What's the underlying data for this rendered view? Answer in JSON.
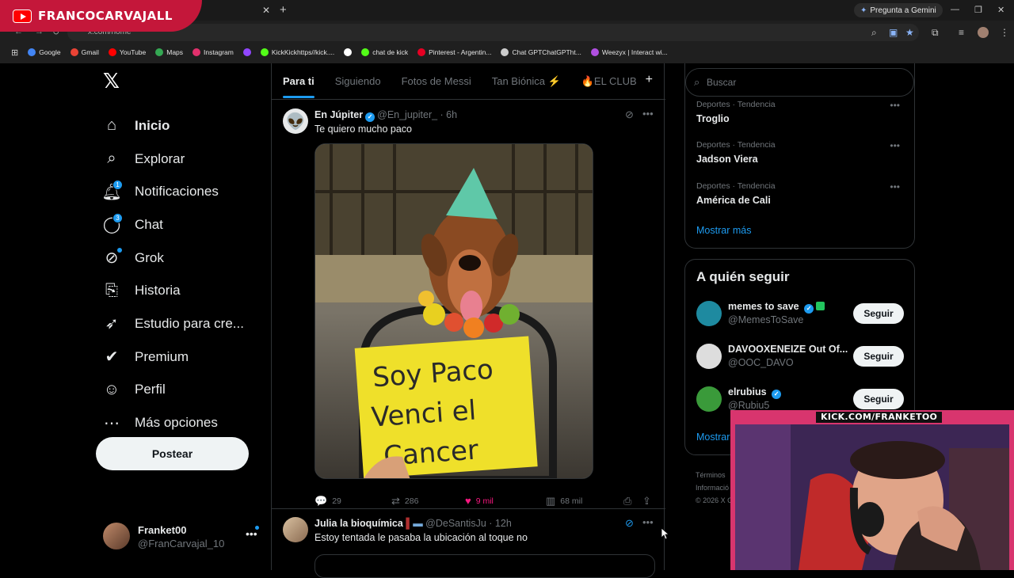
{
  "banner": {
    "title": "FRANCOCARVAJALL"
  },
  "browser": {
    "address": "x.com/home",
    "gemini_label": "Pregunta a Gemini",
    "bookmarks": [
      {
        "label": "Google",
        "color": "#4285f4"
      },
      {
        "label": "Gmail",
        "color": "#ea4335"
      },
      {
        "label": "YouTube",
        "color": "#ff0000"
      },
      {
        "label": "Maps",
        "color": "#34a853"
      },
      {
        "label": "Instagram",
        "color": "#e1306c"
      },
      {
        "label": "",
        "color": "#9146ff"
      },
      {
        "label": "KickKickhttps//kick....",
        "color": "#53fc18"
      },
      {
        "label": "",
        "color": "#ffffff"
      },
      {
        "label": "chat de kick",
        "color": "#53fc18"
      },
      {
        "label": "Pinterest - Argentin...",
        "color": "#e60023"
      },
      {
        "label": "Chat GPTChatGPTht...",
        "color": "#cccccc"
      },
      {
        "label": "Weezyx | Interact wi...",
        "color": "#b04fe0"
      }
    ]
  },
  "nav": {
    "items": [
      {
        "label": "Inicio",
        "icon": "home-icon",
        "badge": ""
      },
      {
        "label": "Explorar",
        "icon": "search-icon",
        "badge": ""
      },
      {
        "label": "Notificaciones",
        "icon": "bell-icon",
        "badge": "1"
      },
      {
        "label": "Chat",
        "icon": "chat-icon",
        "badge": "3"
      },
      {
        "label": "Grok",
        "icon": "grok-icon",
        "badge": ""
      },
      {
        "label": "Historia",
        "icon": "bookmark-icon",
        "badge": ""
      },
      {
        "label": "Estudio para cre...",
        "icon": "rocket-icon",
        "badge": ""
      },
      {
        "label": "Premium",
        "icon": "verified-icon",
        "badge": ""
      },
      {
        "label": "Perfil",
        "icon": "person-icon",
        "badge": ""
      },
      {
        "label": "Más opciones",
        "icon": "more-circle-icon",
        "badge": ""
      }
    ],
    "post_label": "Postear"
  },
  "profile": {
    "name": "Franket00",
    "handle": "@FranCarvajal_10"
  },
  "tabs": [
    {
      "label": "Para ti",
      "active": true
    },
    {
      "label": "Siguiendo",
      "active": false
    },
    {
      "label": "Fotos de Messi",
      "active": false
    },
    {
      "label": "Tan Biónica ⚡",
      "active": false
    },
    {
      "label": "🔥EL CLUB",
      "active": false
    }
  ],
  "tweets": [
    {
      "name": "En Júpiter",
      "handle": "@En_jupiter_",
      "time": "· 6h",
      "text": "Te quiero mucho paco",
      "sign_text": "Soy Paco Venci el Cancer",
      "replies": "29",
      "reposts": "286",
      "likes": "9 mil",
      "views": "68 mil"
    },
    {
      "name": "Julia la bioquímica",
      "handle": "@DeSantisJu",
      "time": "· 12h",
      "text": "Estoy tentada le pasaba la ubicación al toque no"
    }
  ],
  "search": {
    "placeholder": "Buscar"
  },
  "trends": [
    {
      "category": "Deportes · Tendencia",
      "title": "Troglio"
    },
    {
      "category": "Deportes · Tendencia",
      "title": "Jadson Viera"
    },
    {
      "category": "Deportes · Tendencia",
      "title": "América de Cali"
    }
  ],
  "trends_show_more": "Mostrar más",
  "who_to_follow": {
    "title": "A quién seguir",
    "accounts": [
      {
        "name": "memes to save",
        "handle": "@MemesToSave",
        "color": "#1e8aa0"
      },
      {
        "name": "DAVOOXENEIZE Out Of...",
        "handle": "@OOC_DAVO",
        "color": "#dddddd"
      },
      {
        "name": "elrubius",
        "handle": "@Rubiu5",
        "color": "#3a9a3a"
      }
    ],
    "follow_label": "Seguir",
    "show_more": "Mostrar"
  },
  "footer": {
    "line1": "Términos",
    "line2": "Informació",
    "line3": "© 2026 X C"
  },
  "cam": {
    "label": "KICK.COM/FRANKETOO"
  }
}
